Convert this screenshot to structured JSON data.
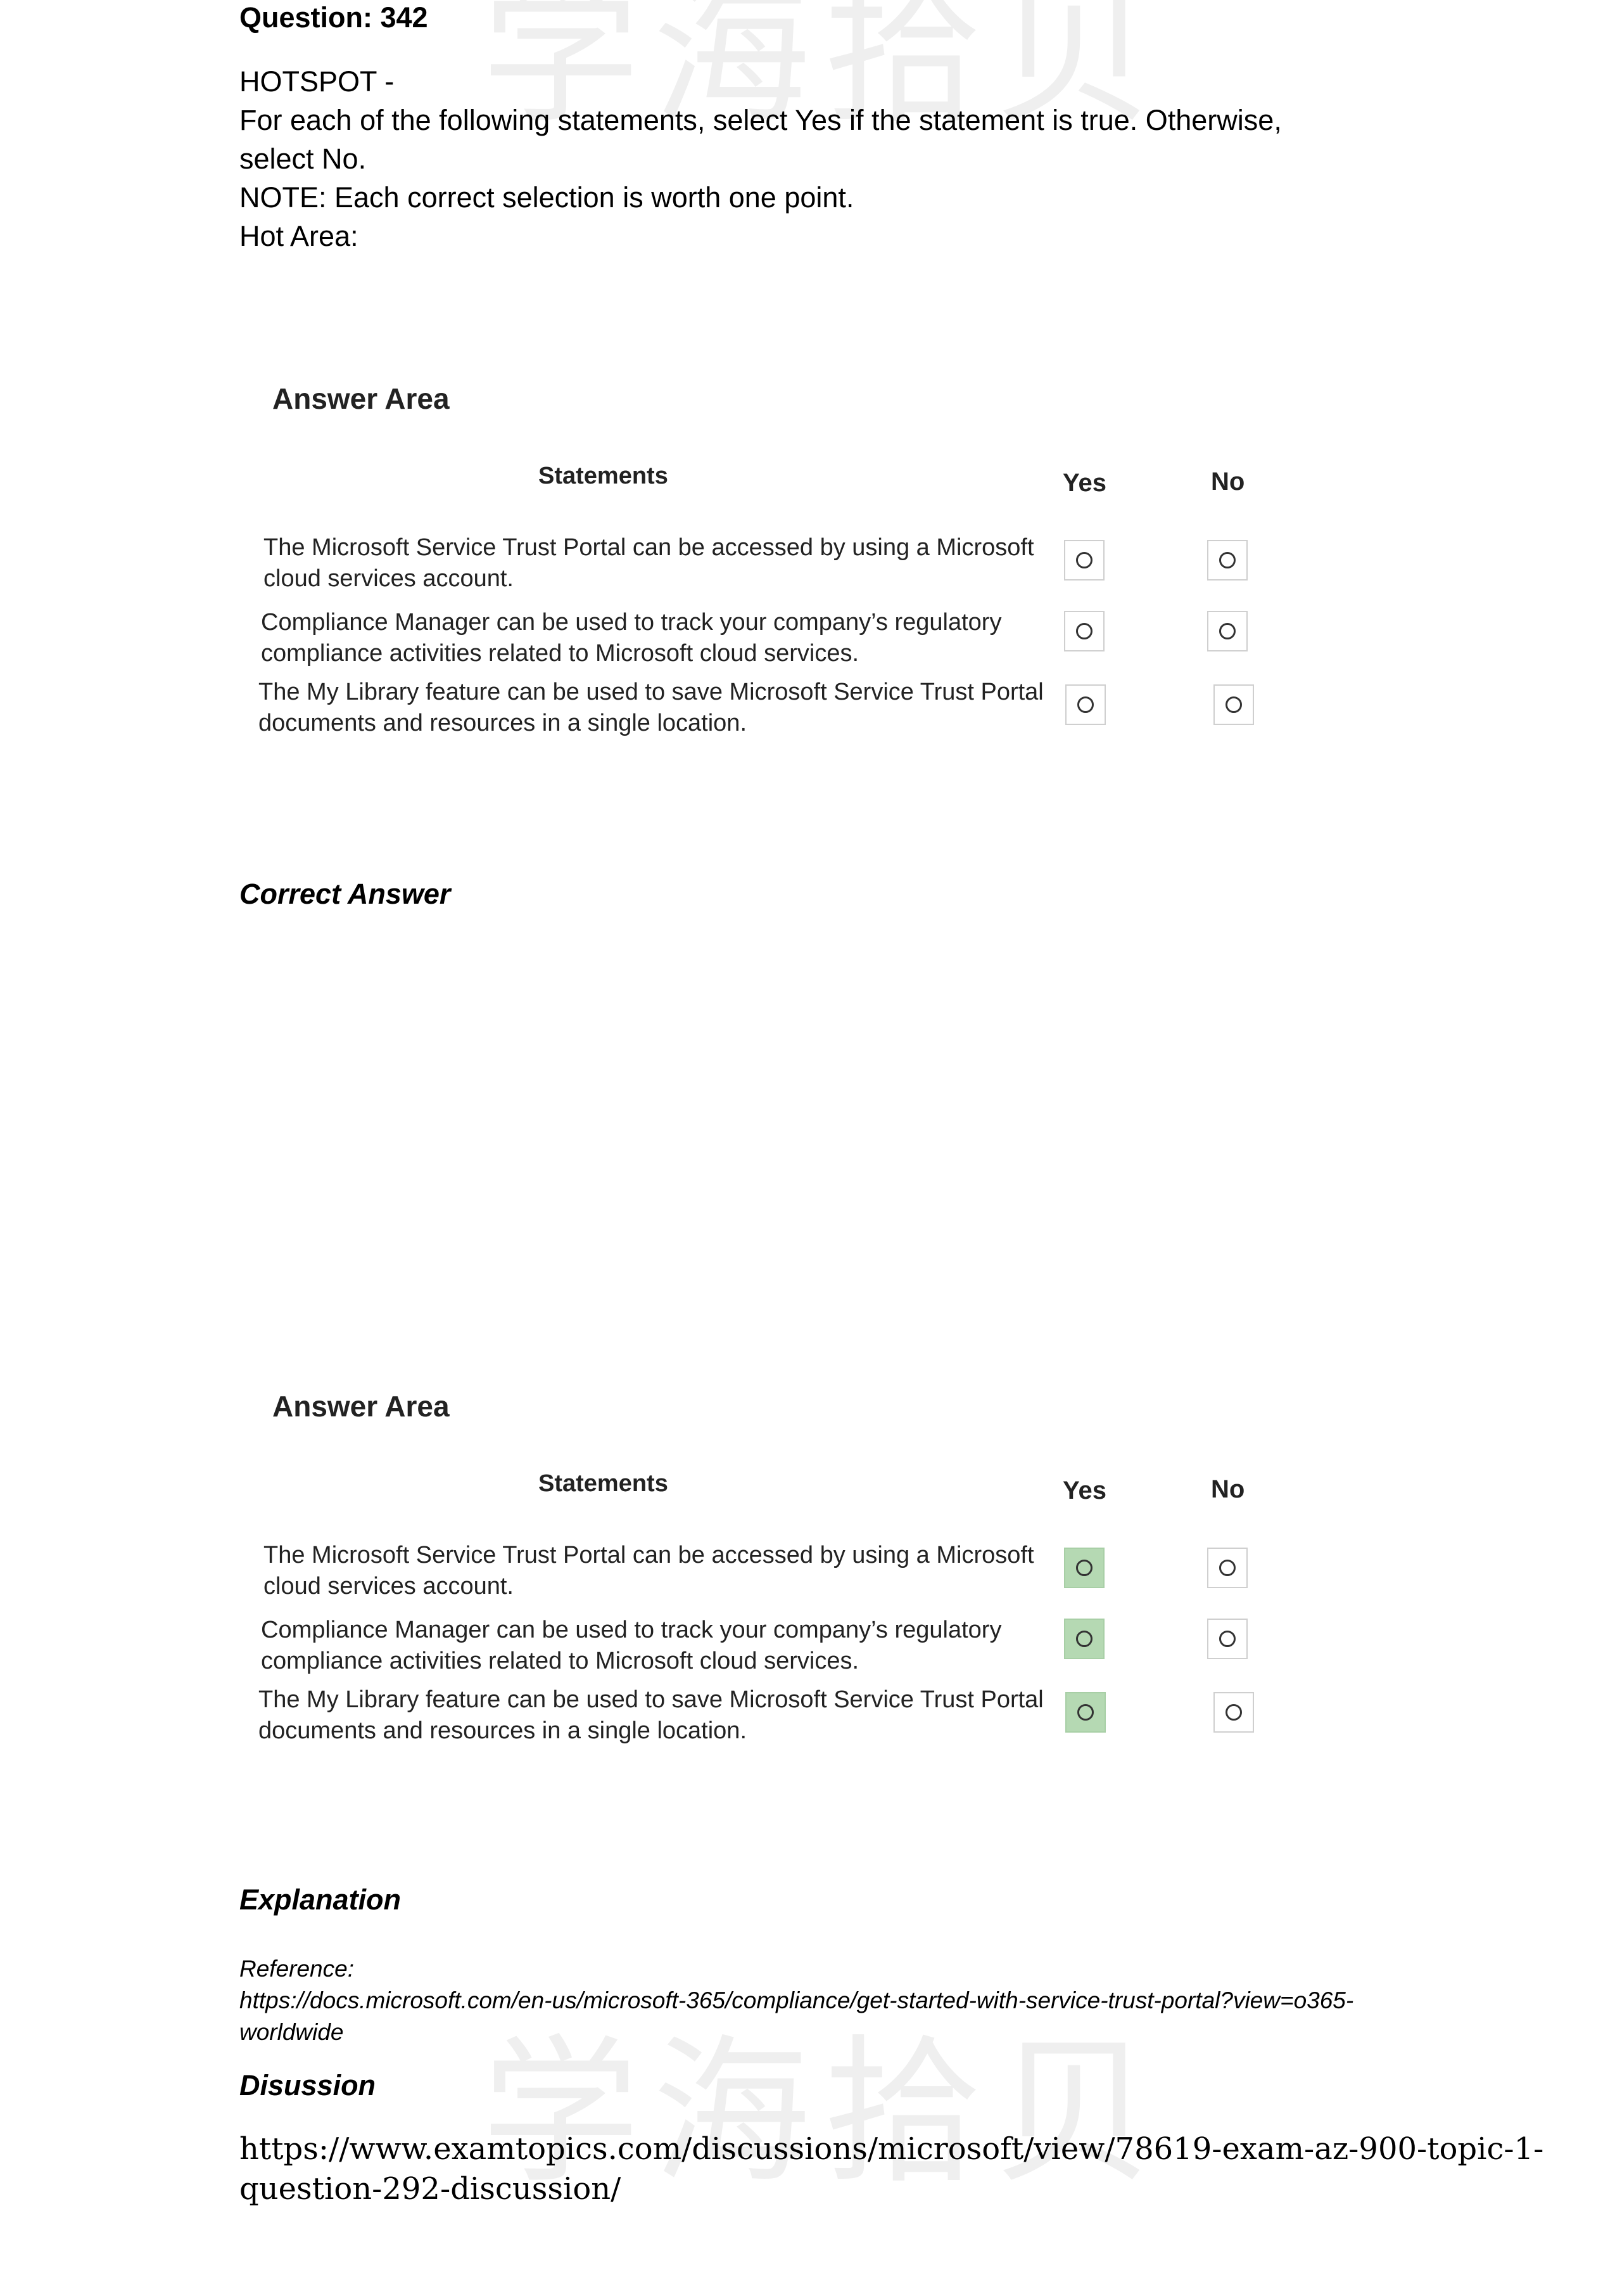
{
  "watermark": "学海拾贝",
  "question": {
    "title": "Question: 342"
  },
  "intro": {
    "lines": [
      "HOTSPOT -",
      "For each of the following statements, select Yes if the statement is true. Otherwise,",
      "select No.",
      "NOTE: Each correct selection is worth one point.",
      "Hot Area:"
    ]
  },
  "hot_area": {
    "title": "Answer Area",
    "statements_header": "Statements",
    "yes_header": "Yes",
    "no_header": "No",
    "rows": [
      {
        "lines": [
          "The Microsoft Service Trust Portal can be accessed by using a Microsoft",
          "cloud services account."
        ],
        "selected": ""
      },
      {
        "lines": [
          "Compliance Manager can be used to track your company’s regulatory",
          "compliance activities related to Microsoft cloud services."
        ],
        "selected": ""
      },
      {
        "lines": [
          "The My Library feature can be used to save Microsoft Service Trust Portal",
          "documents and resources in a single location."
        ],
        "selected": ""
      }
    ]
  },
  "correct_answer_label": "Correct Answer",
  "correct_area": {
    "title": "Answer Area",
    "statements_header": "Statements",
    "yes_header": "Yes",
    "no_header": "No",
    "rows": [
      {
        "lines": [
          "The Microsoft Service Trust Portal can be accessed by using a Microsoft",
          "cloud services account."
        ],
        "selected": "yes"
      },
      {
        "lines": [
          "Compliance Manager can be used to track your company’s regulatory",
          "compliance activities related to Microsoft cloud services."
        ],
        "selected": "yes"
      },
      {
        "lines": [
          "The My Library feature can be used to save Microsoft Service Trust Portal",
          "documents and resources in a single location."
        ],
        "selected": "yes"
      }
    ]
  },
  "explanation": {
    "label": "Explanation",
    "reference_label": "Reference:",
    "reference_lines": [
      "https://docs.microsoft.com/en-us/microsoft-365/compliance/get-started-with-service-trust-portal?view=o365-",
      "worldwide"
    ]
  },
  "discussion": {
    "label": "Disussion",
    "url_lines": [
      "https://www.examtopics.com/discussions/microsoft/view/78619-exam-az-900-topic-1-",
      "question-292-discussion/"
    ]
  },
  "colors": {
    "selected_fill": "#b5d9b3",
    "option_border": "#cfcfcf"
  }
}
